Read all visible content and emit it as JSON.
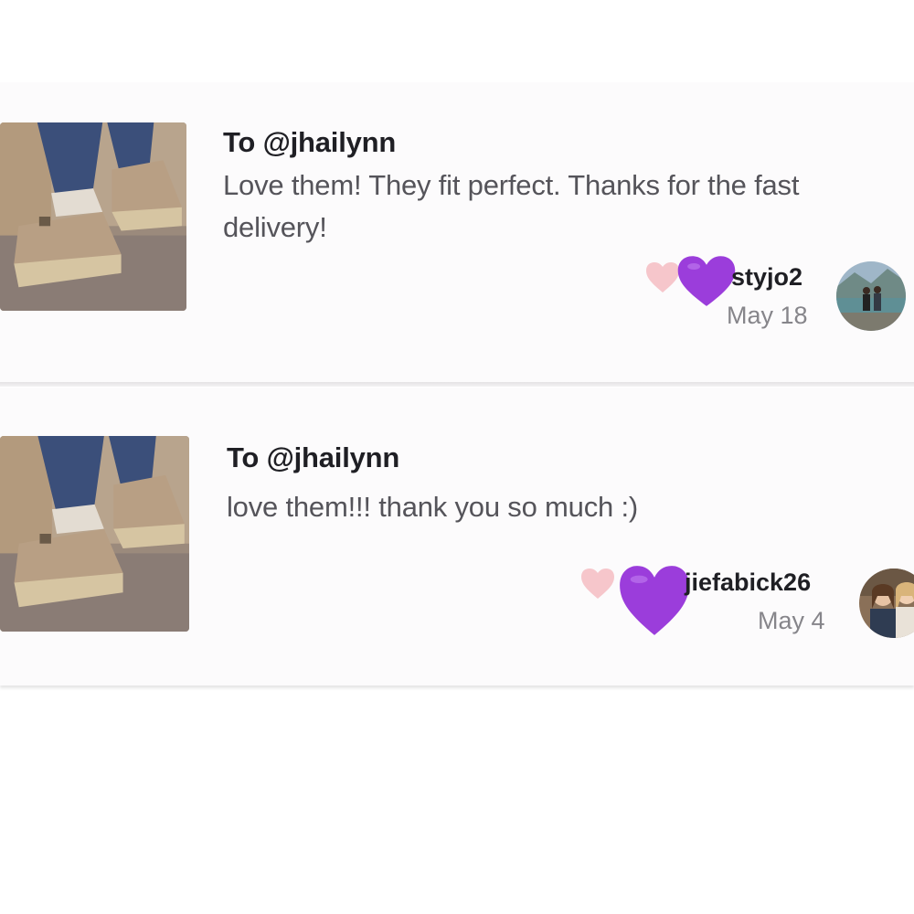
{
  "reviews": [
    {
      "to_line": "To @jhailynn",
      "message": "Love them! They fit perfect. Thanks for the fast delivery!",
      "username": "styjo2",
      "date": "May 18",
      "product_image": "sandal-photo",
      "avatar_image": "user-avatar-photo"
    },
    {
      "to_line": "To @jhailynn",
      "message": "love them!!! thank you so much :)",
      "username": "jiefabick26",
      "date": "May 4",
      "product_image": "sandal-photo",
      "avatar_image": "user-avatar-photo"
    }
  ],
  "icons": {
    "small_heart": "pink-heart-icon",
    "big_heart": "purple-heart-icon"
  },
  "colors": {
    "small_heart": "#f6c6cb",
    "big_heart": "#9b3ddb",
    "card_background": "#fcfbfc",
    "username_text": "#1f1f24",
    "message_text": "#55545a",
    "date_text": "#86858a"
  }
}
